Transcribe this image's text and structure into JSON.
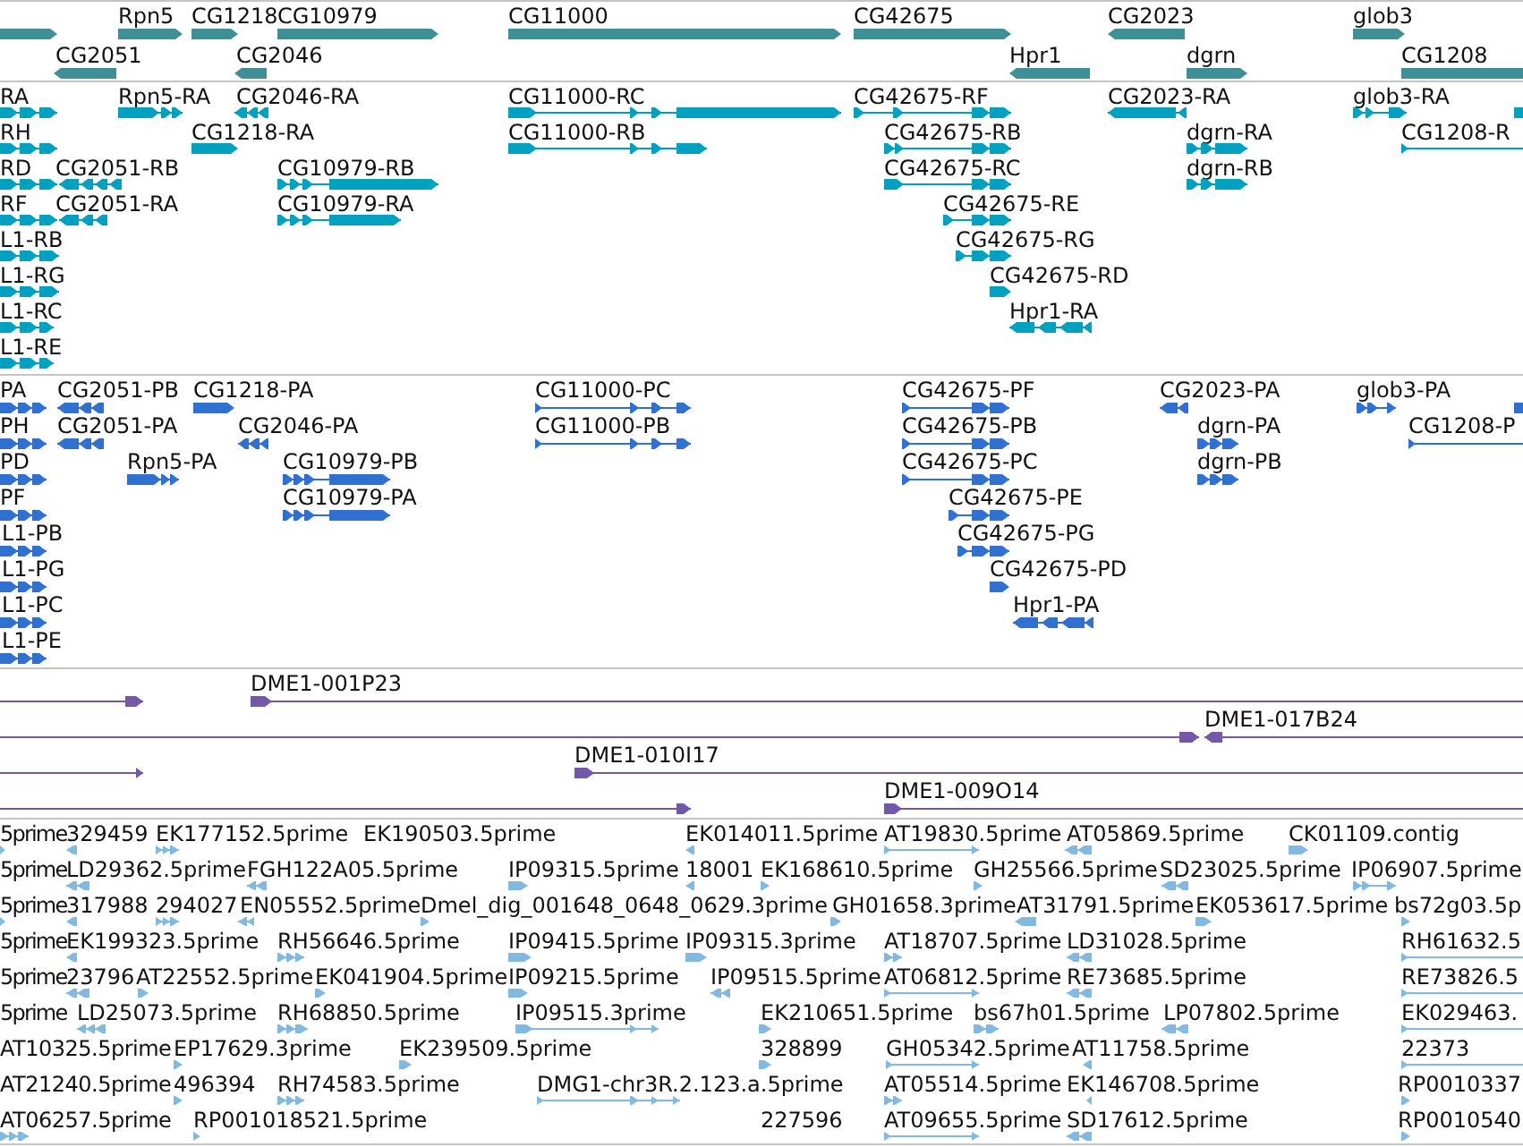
{
  "tracks": [
    {
      "kind": "gene",
      "color": "#3e8f96",
      "features": [
        {
          "reverse": false
        },
        {
          "label": "Rpn5",
          "reverse": false
        },
        {
          "label": "CG1218",
          "reverse": false
        },
        {
          "label": "CG10979",
          "reverse": false
        },
        {
          "label": "CG11000",
          "reverse": false
        },
        {
          "label": "CG42675",
          "reverse": false
        },
        {
          "label": "CG2023",
          "reverse": true
        },
        {
          "label": "glob3",
          "reverse": false
        },
        {
          "label": "CG2051",
          "reverse": true
        },
        {
          "label": "CG2046",
          "reverse": true
        },
        {
          "label": "Hpr1",
          "reverse": true
        },
        {
          "label": "dgrn",
          "reverse": false
        },
        {
          "label": "CG1208",
          "reverse": false
        }
      ]
    },
    {
      "kind": "transcript",
      "color": "#00a0c0",
      "features": [
        {
          "label": "RA",
          "reverse": false
        },
        {
          "label": "Rpn5-RA",
          "reverse": false
        },
        {
          "label": "CG2046-RA",
          "reverse": true
        },
        {
          "label": "CG11000-RC",
          "reverse": false
        },
        {
          "label": "CG42675-RF",
          "reverse": false
        },
        {
          "label": "CG2023-RA",
          "reverse": true
        },
        {
          "label": "glob3-RA",
          "reverse": false
        },
        {
          "reverse": false
        },
        {
          "label": "RH",
          "reverse": false
        },
        {
          "label": "CG1218-RA",
          "reverse": false
        },
        {
          "label": "CG11000-RB",
          "reverse": false
        },
        {
          "label": "CG42675-RB",
          "reverse": false
        },
        {
          "label": "dgrn-RA",
          "reverse": false
        },
        {
          "label": "CG1208-R",
          "reverse": false
        },
        {
          "label": "RD",
          "reverse": false
        },
        {
          "label": "CG2051-RB",
          "reverse": true
        },
        {
          "label": "CG10979-RB",
          "reverse": false
        },
        {
          "label": "CG42675-RC",
          "reverse": false
        },
        {
          "label": "dgrn-RB",
          "reverse": false
        },
        {
          "label": "RF",
          "reverse": false
        },
        {
          "label": "CG2051-RA",
          "reverse": true
        },
        {
          "label": "CG10979-RA",
          "reverse": false
        },
        {
          "label": "CG42675-RE",
          "reverse": false
        },
        {
          "label": "L1-RB",
          "reverse": false
        },
        {
          "label": "CG42675-RG",
          "reverse": false
        },
        {
          "label": "L1-RG",
          "reverse": false
        },
        {
          "label": "CG42675-RD",
          "reverse": false
        },
        {
          "label": "L1-RC",
          "reverse": false
        },
        {
          "label": "Hpr1-RA",
          "reverse": true
        },
        {
          "label": "L1-RE",
          "reverse": false
        }
      ]
    },
    {
      "kind": "protein",
      "color": "#3070d0",
      "features": [
        {
          "label": "PA",
          "reverse": false
        },
        {
          "label": "CG2051-PB",
          "reverse": true
        },
        {
          "label": "CG1218-PA",
          "reverse": false
        },
        {
          "label": "CG11000-PC",
          "reverse": false
        },
        {
          "label": "CG42675-PF",
          "reverse": false
        },
        {
          "label": "CG2023-PA",
          "reverse": true
        },
        {
          "label": "glob3-PA",
          "reverse": false
        },
        {
          "reverse": false
        },
        {
          "label": "PH",
          "reverse": false
        },
        {
          "label": "CG2051-PA",
          "reverse": true
        },
        {
          "label": "CG2046-PA",
          "reverse": true
        },
        {
          "label": "CG11000-PB",
          "reverse": false
        },
        {
          "label": "CG42675-PB",
          "reverse": false
        },
        {
          "label": "dgrn-PA",
          "reverse": false
        },
        {
          "label": "CG1208-P",
          "reverse": false
        },
        {
          "label": "PD",
          "reverse": false
        },
        {
          "label": "Rpn5-PA",
          "reverse": false
        },
        {
          "label": "CG10979-PB",
          "reverse": false
        },
        {
          "label": "CG42675-PC",
          "reverse": false
        },
        {
          "label": "dgrn-PB",
          "reverse": false
        },
        {
          "label": "PF",
          "reverse": false
        },
        {
          "label": "CG10979-PA",
          "reverse": false
        },
        {
          "label": "CG42675-PE",
          "reverse": false
        },
        {
          "label": "L1-PB",
          "reverse": false
        },
        {
          "label": "CG42675-PG",
          "reverse": false
        },
        {
          "label": "L1-PG",
          "reverse": false
        },
        {
          "label": "CG42675-PD",
          "reverse": false
        },
        {
          "label": "L1-PC",
          "reverse": false
        },
        {
          "label": "Hpr1-PA",
          "reverse": true
        },
        {
          "label": "L1-PE",
          "reverse": false
        }
      ]
    },
    {
      "kind": "clone",
      "color": "#7458a8",
      "features": [
        {
          "reverse": false
        },
        {
          "label": "DME1-001P23",
          "reverse": false
        },
        {
          "reverse": false
        },
        {
          "label": "DME1-017B24",
          "reverse": true
        },
        {
          "reverse": false
        },
        {
          "label": "DME1-010I17",
          "reverse": false
        },
        {
          "reverse": false
        },
        {
          "label": "DME1-009O14",
          "reverse": false
        }
      ]
    },
    {
      "kind": "read",
      "color": "#82b9e1",
      "features": [
        {
          "label": "5prime",
          "reverse": false
        },
        {
          "label": "329459",
          "reverse": true
        },
        {
          "label": "EK177152.5prime",
          "reverse": false
        },
        {
          "label": "EK190503.5prime"
        },
        {
          "label": "EK014011.5prime",
          "reverse": true
        },
        {
          "label": "AT19830.5prime",
          "reverse": false
        },
        {
          "label": "AT05869.5prime",
          "reverse": true
        },
        {
          "label": "CK01109.contig",
          "reverse": false
        },
        {
          "label": "5prime"
        },
        {
          "label": "LD29362.5prime",
          "reverse": true
        },
        {
          "label": "FGH122A05.5prime",
          "reverse": true
        },
        {
          "label": "IP09315.5prime",
          "reverse": false
        },
        {
          "label": "18001",
          "reverse": true
        },
        {
          "label": "EK168610.5prime",
          "reverse": false
        },
        {
          "label": "GH25566.5prime",
          "reverse": false
        },
        {
          "label": "SD23025.5prime",
          "reverse": true
        },
        {
          "label": "IP06907.5prime",
          "reverse": false
        },
        {
          "label": "5prime",
          "reverse": false
        },
        {
          "label": "317988",
          "reverse": true
        },
        {
          "label": "294027",
          "reverse": false
        },
        {
          "label": "EN05552.5prime",
          "reverse": true
        },
        {
          "label": "Dmel_dig_001648_0648_0629.3prime",
          "reverse": false
        },
        {
          "label": "GH01658.3prime",
          "reverse": false
        },
        {
          "label": "AT31791.5prime",
          "reverse": true
        },
        {
          "label": "EK053617.5prime",
          "reverse": false
        },
        {
          "label": "bs72g03.5p",
          "reverse": false
        },
        {
          "label": "5prime"
        },
        {
          "label": "EK199323.5prime",
          "reverse": true
        },
        {
          "label": "RH56646.5prime",
          "reverse": false
        },
        {
          "label": "IP09415.5prime",
          "reverse": false
        },
        {
          "label": "IP09315.3prime",
          "reverse": false
        },
        {
          "label": "AT18707.5prime",
          "reverse": false
        },
        {
          "label": "LD31028.5prime",
          "reverse": true
        },
        {
          "label": "RH61632.5",
          "reverse": false
        },
        {
          "label": "5prime"
        },
        {
          "label": "23796",
          "reverse": true
        },
        {
          "label": "AT22552.5prime",
          "reverse": false
        },
        {
          "label": "EK041904.5prime",
          "reverse": false
        },
        {
          "label": "IP09215.5prime",
          "reverse": false
        },
        {
          "label": "IP09515.5prime",
          "reverse": true
        },
        {
          "label": "AT06812.5prime",
          "reverse": false
        },
        {
          "label": "RE73685.5prime",
          "reverse": true
        },
        {
          "label": "RE73826.5",
          "reverse": false
        },
        {
          "label": "5prime"
        },
        {
          "label": "LD25073.5prime",
          "reverse": true
        },
        {
          "label": "RH68850.5prime",
          "reverse": false
        },
        {
          "label": "IP09515.3prime",
          "reverse": false
        },
        {
          "label": "EK210651.5prime",
          "reverse": false
        },
        {
          "label": "bs67h01.5prime",
          "reverse": false
        },
        {
          "label": "LP07802.5prime",
          "reverse": true
        },
        {
          "label": "EK029463.",
          "reverse": false
        },
        {
          "label": "AT10325.5prime"
        },
        {
          "label": "EP17629.3prime",
          "reverse": false
        },
        {
          "label": "EK239509.5prime",
          "reverse": false
        },
        {
          "label": "328899",
          "reverse": false
        },
        {
          "label": "GH05342.5prime",
          "reverse": false
        },
        {
          "label": "AT11758.5prime",
          "reverse": true
        },
        {
          "label": "22373",
          "reverse": false
        },
        {
          "label": "AT21240.5prime"
        },
        {
          "label": "496394",
          "reverse": false
        },
        {
          "label": "RH74583.5prime",
          "reverse": false
        },
        {
          "label": "DMG1-chr3R.2.123.a.5prime",
          "reverse": false
        },
        {
          "label": "AT05514.5prime",
          "reverse": false
        },
        {
          "label": "EK146708.5prime",
          "reverse": true
        },
        {
          "label": "RP0010337",
          "reverse": false
        },
        {
          "label": "AT06257.5prime",
          "reverse": false
        },
        {
          "label": "RP001018521.5prime",
          "reverse": false
        },
        {
          "label": "227596"
        },
        {
          "label": "AT09655.5prime",
          "reverse": false
        },
        {
          "label": "SD17612.5prime",
          "reverse": true
        },
        {
          "label": "RP0010540",
          "reverse": false
        }
      ]
    }
  ]
}
